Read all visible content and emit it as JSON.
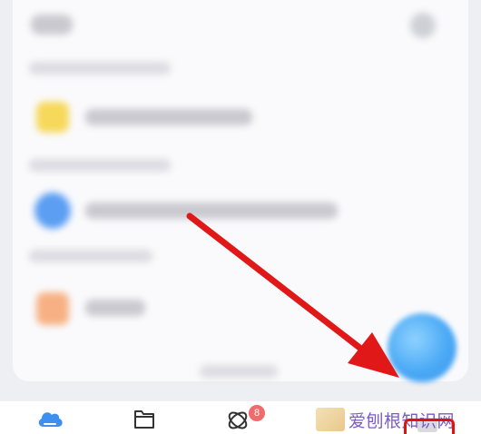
{
  "nav": {
    "items": [
      {
        "name": "cloud",
        "icon": "cloud-icon",
        "color": "#3d8ff0"
      },
      {
        "name": "files",
        "icon": "folder-icon"
      },
      {
        "name": "discover",
        "icon": "orbit-icon",
        "badge": "8"
      },
      {
        "name": "me",
        "icon": "profile-icon"
      }
    ]
  },
  "watermark": {
    "text": "爱刨根知识网"
  },
  "colors": {
    "arrow": "#e01818",
    "highlight": "#e21212",
    "accent": "#3d8ff0",
    "badge": "#f06b6b"
  }
}
